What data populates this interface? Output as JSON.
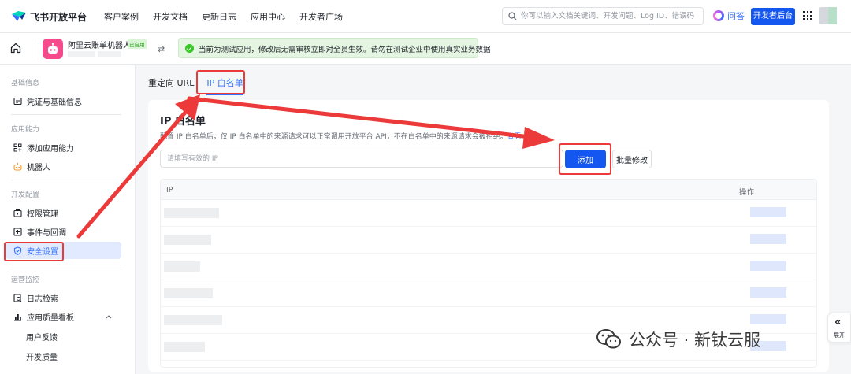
{
  "topnav": {
    "brand": "飞书开放平台",
    "links": [
      "客户案例",
      "开发文档",
      "更新日志",
      "应用中心",
      "开发者广场"
    ],
    "search_placeholder": "你可以输入文档关键词、开发问题、Log ID、错误码",
    "qa_label": "问答",
    "dev_console_label": "开发者后台",
    "brand_color": "#1456f0"
  },
  "appbar": {
    "app_name": "阿里云账单机器人",
    "app_status": "已启用",
    "alert": "当前为测试应用，修改后无需审核立即对全员生效。请勿在测试企业中使用真实业务数据"
  },
  "sidebar": {
    "groups": [
      {
        "label": "基础信息",
        "items": [
          {
            "label": "凭证与基础信息",
            "icon": "id-card-icon"
          }
        ]
      },
      {
        "label": "应用能力",
        "items": [
          {
            "label": "添加应用能力",
            "icon": "apps-icon"
          },
          {
            "label": "机器人",
            "icon": "robot-icon"
          }
        ]
      },
      {
        "label": "开发配置",
        "items": [
          {
            "label": "权限管理",
            "icon": "permission-icon"
          },
          {
            "label": "事件与回调",
            "icon": "event-icon"
          },
          {
            "label": "安全设置",
            "icon": "shield-icon",
            "active": true
          }
        ]
      },
      {
        "label": "运营监控",
        "items": [
          {
            "label": "日志检索",
            "icon": "log-search-icon"
          },
          {
            "label": "应用质量看板",
            "icon": "dashboard-icon"
          }
        ],
        "subitems": [
          "用户反馈",
          "开发质量"
        ]
      }
    ]
  },
  "tabs": [
    {
      "label": "重定向 URL",
      "active": false
    },
    {
      "label": "IP 白名单",
      "active": true
    }
  ],
  "section": {
    "title": "IP 白名单",
    "description": "配置 IP 白名单后，仅 IP 白名单中的来源请求可以正常调用开放平台 API，不在白名单中的来源请求会被拒绝。",
    "link": "查看",
    "input_placeholder": "请填写有效的 IP",
    "add_label": "添加",
    "batch_label": "批量修改",
    "table_headers": {
      "ip": "IP",
      "actions": "操作"
    }
  },
  "expand_label": "展开",
  "watermark": "公众号 · 新钛云服",
  "annotation_color": "#ec3a3a"
}
